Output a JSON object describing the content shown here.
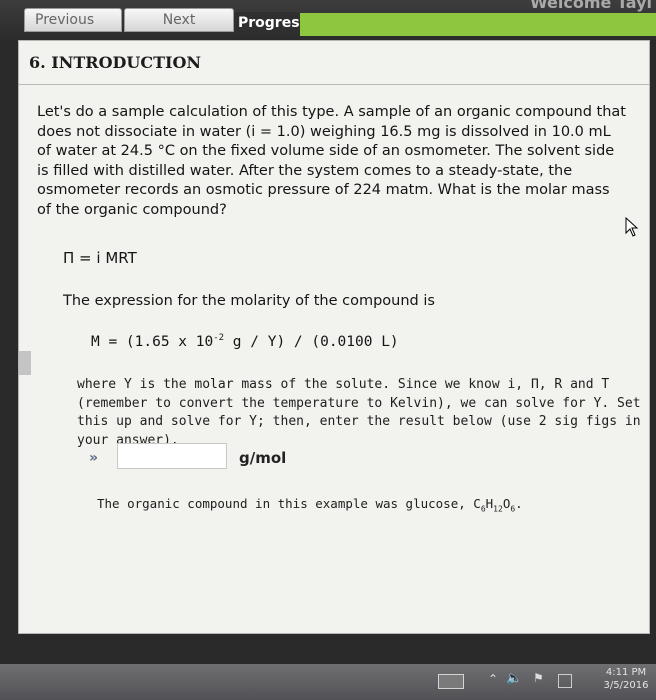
{
  "header": {
    "welcome_text": "Welcome Tayl",
    "tabs": {
      "previous": "Previous",
      "next": "Next",
      "progress": "Progress"
    },
    "progress_fraction": 1.0
  },
  "question": {
    "title": "6. INTRODUCTION",
    "intro": "Let's do a sample calculation of this type. A sample of an organic compound that does not dissociate in water (i = 1.0) weighing 16.5 mg is dissolved in 10.0 mL of water at 24.5 °C on the fixed volume side of an osmometer. The solvent side is filled with distilled water. After the system comes to a steady-state, the osmometer records an osmotic pressure of 224 matm. What is the molar mass of the organic compound?",
    "formula": "Π = i MRT",
    "molarity_label": "The expression for the molarity of the compound is",
    "m_formula_left": "M  =  (1.65 x 10",
    "m_formula_exp": "-2",
    "m_formula_right": " g / Y) / (0.0100 L)",
    "where_text": "where Y is the molar mass of the solute. Since we know i, Π, R and T (remember to convert the temperature to Kelvin), we can solve for Y. Set this up and solve for Y; then, enter the result below (use 2 sig figs in your answer).",
    "answer_value": "",
    "answer_unit": "g/mol",
    "note_prefix": "The organic compound in this example was glucose, C",
    "note_sub1": "6",
    "note_mid1": "H",
    "note_sub2": "12",
    "note_mid2": "O",
    "note_sub3": "6",
    "note_end": "."
  },
  "taskbar": {
    "time": "4:11 PM",
    "date": "3/5/2016"
  },
  "colors": {
    "progress_bar": "#8ec63f",
    "panel_bg": "#f2f2ee"
  }
}
